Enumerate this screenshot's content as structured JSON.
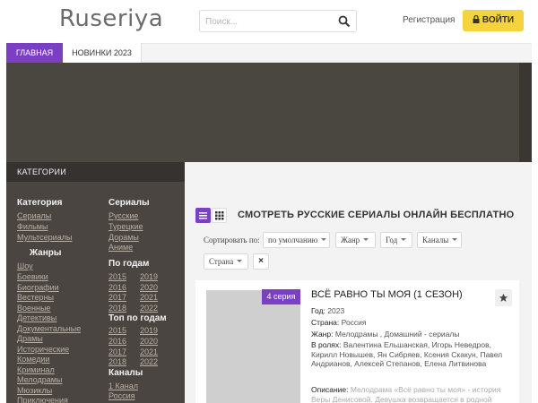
{
  "header": {
    "logo": "Ruseriya",
    "search_placeholder": "Поиск...",
    "register": "Регистрация",
    "login": "ВОЙТИ"
  },
  "nav": {
    "items": [
      "ГЛАВНАЯ",
      "НОВИНКИ 2023"
    ]
  },
  "sidebar": {
    "heading": "КАТЕГОРИИ",
    "category": {
      "title": "Категория",
      "links": [
        "Сериалы",
        "Фильмы",
        "Мультсериалы"
      ]
    },
    "genres": {
      "title": "Жанры",
      "links": [
        "Шоу",
        "Боевики",
        "Биографии",
        "Вестерны",
        "Военные",
        "Детективы",
        "Документальные",
        "Драмы",
        "Исторические",
        "Комедии",
        "Криминал",
        "Мелодрамы",
        "Мюзиклы",
        "Приключения"
      ]
    },
    "serials": {
      "title": "Сериалы",
      "links": [
        "Русские",
        "Турецкие",
        "Дорамы",
        "Аниме"
      ]
    },
    "by_year": {
      "title": "По годам",
      "years": [
        [
          "2015",
          "2019"
        ],
        [
          "2016",
          "2020"
        ],
        [
          "2017",
          "2021"
        ],
        [
          "2018",
          "2022"
        ]
      ]
    },
    "top_by_year": {
      "title": "Топ по годам",
      "years": [
        [
          "2015",
          "2019"
        ],
        [
          "2016",
          "2020"
        ],
        [
          "2017",
          "2021"
        ],
        [
          "2018",
          "2022"
        ]
      ]
    },
    "channels": {
      "title": "Каналы",
      "links": [
        "1 Канал",
        "Россия"
      ]
    }
  },
  "main": {
    "title": "СМОТРЕТЬ РУССКИЕ СЕРИАЛЫ ОНЛАЙН БЕСПЛАТНО",
    "sort_label": "Сортировать по:",
    "filters": {
      "sort": "по умолчанию",
      "genre": "Жанр",
      "year": "Год",
      "channels": "Каналы",
      "country": "Страна",
      "clear": "×"
    }
  },
  "card": {
    "badge": "4 серия",
    "title": "ВСЁ РАВНО ТЫ МОЯ (1 СЕЗОН)",
    "year_label": "Год:",
    "year": "2023",
    "country_label": "Страна:",
    "country": "Россия",
    "genre_label": "Жанр:",
    "genre": "Мелодрамы , Домашний - сериалы",
    "cast_label": "В ролях:",
    "cast": "Валентина Ельшанская, Игорь Неведров, Кирилл Новышев, Ян Сибряев, Ксения Скакун, Павел Андрианов, Алексей Степанов, Елена Литвинова",
    "desc_label": "Описание:",
    "desc": "Мелодрама «Всё равно ты моя» - история Веры Денисовой. Девушка возвращается в родной"
  },
  "colors": {
    "accent": "#7b3fc4",
    "login_button": "#f5d33f",
    "sidebar_bg": "#4a4540"
  }
}
